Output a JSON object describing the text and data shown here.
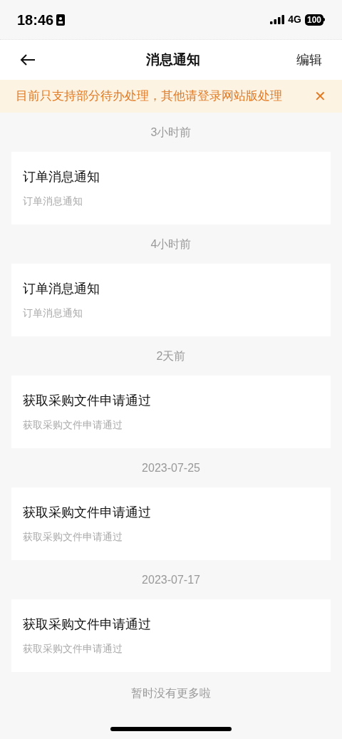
{
  "status_bar": {
    "time": "18:46",
    "network": "4G",
    "battery": "100"
  },
  "nav": {
    "title": "消息通知",
    "action": "编辑"
  },
  "notice": {
    "text": "目前只支持部分待办处理，其他请登录网站版处理",
    "close": "✕"
  },
  "groups": [
    {
      "time": "3小时前",
      "title": "订单消息通知",
      "body": "订单消息通知"
    },
    {
      "time": "4小时前",
      "title": "订单消息通知",
      "body": "订单消息通知"
    },
    {
      "time": "2天前",
      "title": "获取采购文件申请通过",
      "body": "获取采购文件申请通过"
    },
    {
      "time": "2023-07-25",
      "title": "获取采购文件申请通过",
      "body": "获取采购文件申请通过"
    },
    {
      "time": "2023-07-17",
      "title": "获取采购文件申请通过",
      "body": "获取采购文件申请通过"
    }
  ],
  "footer": "暂时没有更多啦"
}
